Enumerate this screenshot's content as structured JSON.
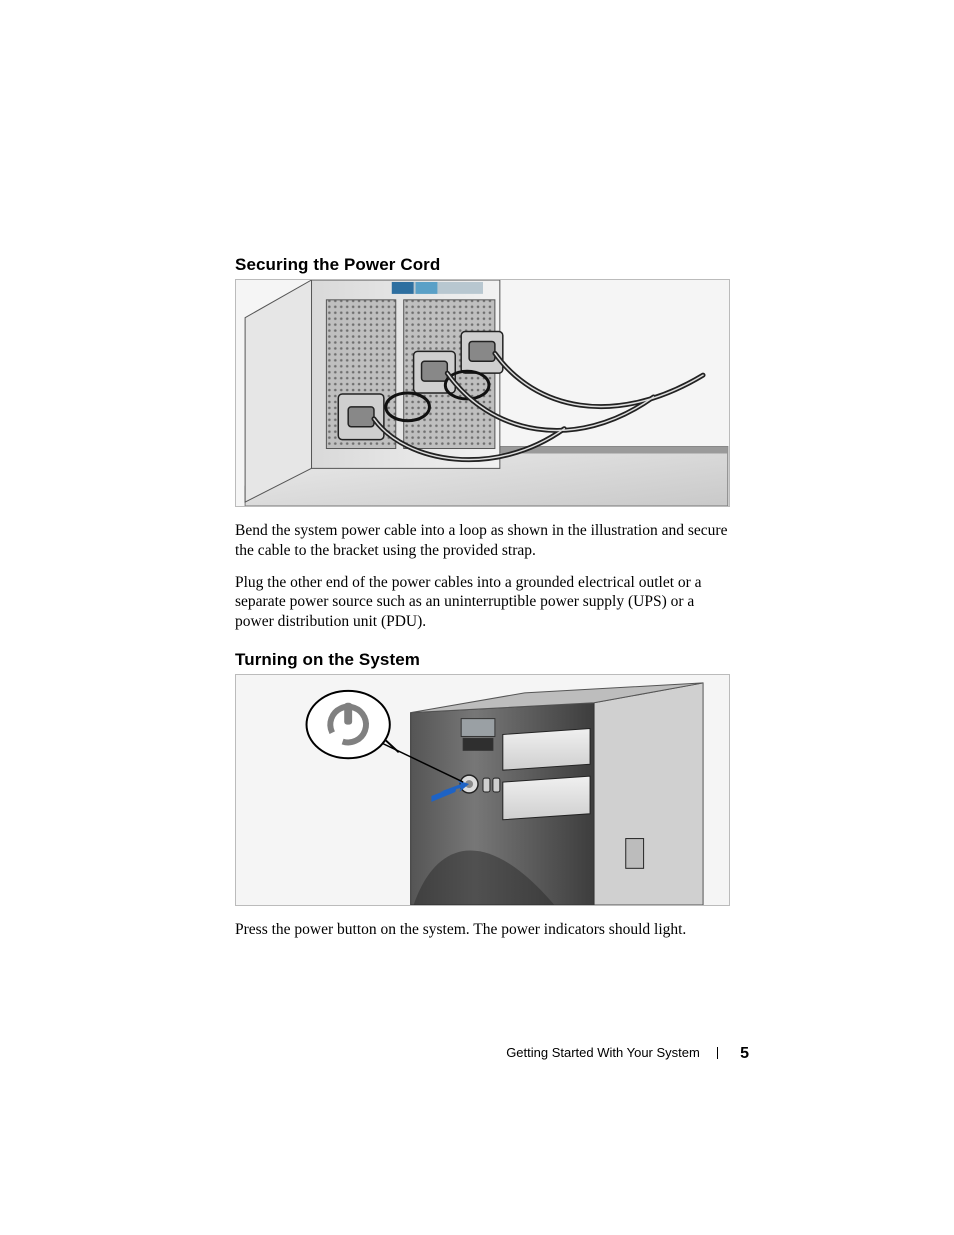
{
  "sections": {
    "securing": {
      "heading": "Securing the Power Cord",
      "para1": "Bend the system power cable into a loop as shown in the illustration and secure the cable to the bracket using the provided strap.",
      "para2": "Plug the other end of the power cables into a grounded electrical outlet or a separate power source such as an uninterruptible power supply (UPS) or a power distribution unit (PDU)."
    },
    "turning_on": {
      "heading": "Turning on the System",
      "para1": "Press the power button on the system. The power indicators should light."
    }
  },
  "footer": {
    "section_title": "Getting Started With Your System",
    "page_number": "5"
  }
}
